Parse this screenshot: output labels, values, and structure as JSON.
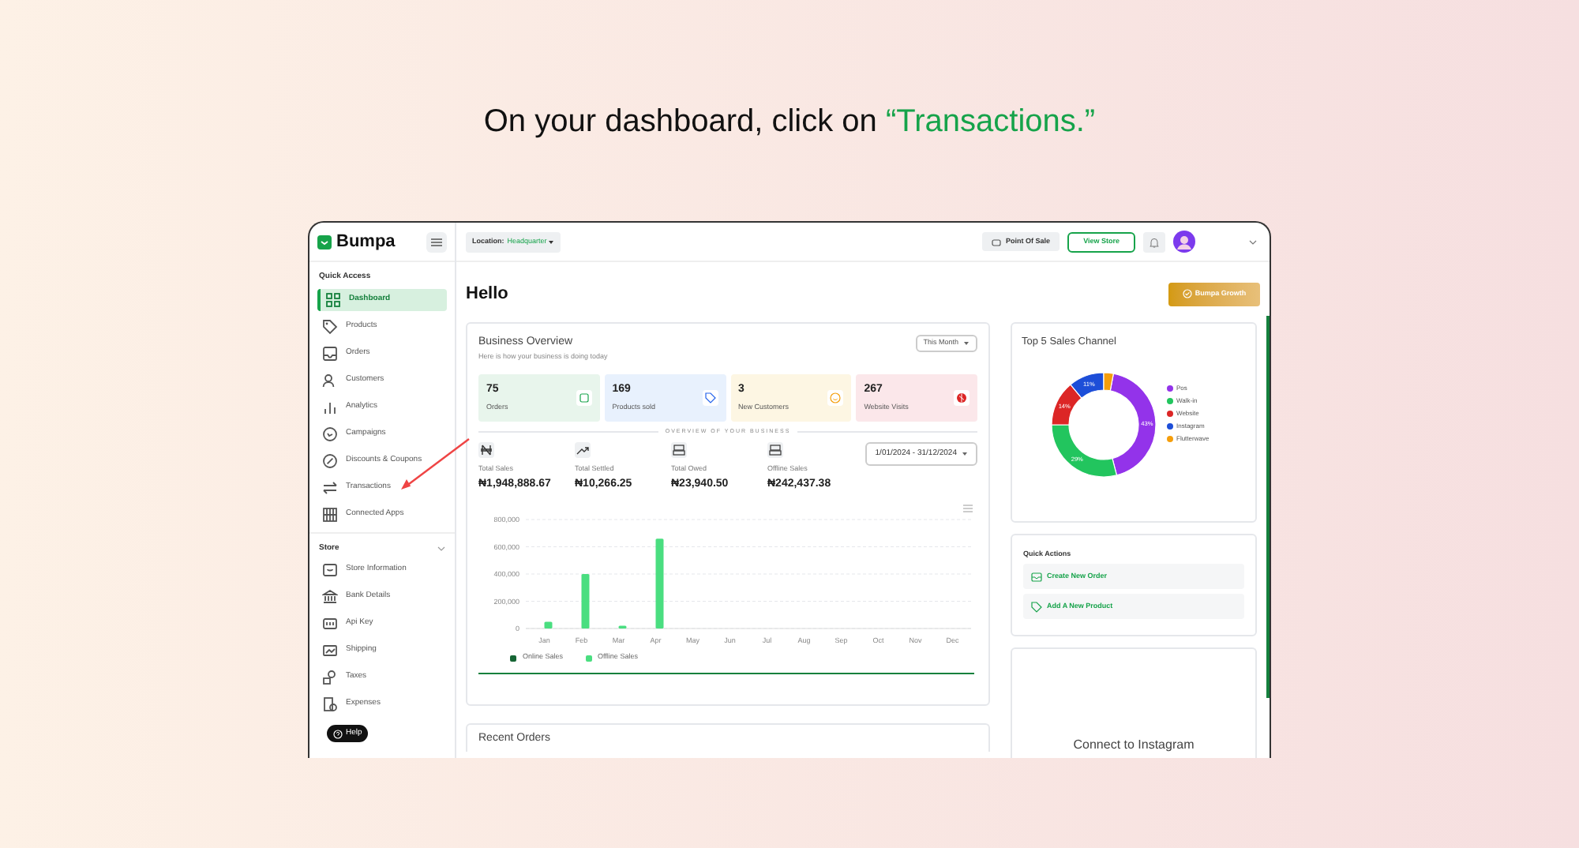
{
  "instruction": {
    "text": "On your dashboard, click on ",
    "highlight": "“Transactions.”"
  },
  "sidebar": {
    "brand": "Bumpa",
    "sections": [
      {
        "title": "Quick Access",
        "items": [
          {
            "label": "Dashboard",
            "selected": true
          },
          {
            "label": "Products",
            "selected": false
          },
          {
            "label": "Orders",
            "selected": false
          },
          {
            "label": "Customers",
            "selected": false
          },
          {
            "label": "Analytics",
            "selected": false
          },
          {
            "label": "Campaigns",
            "selected": false
          },
          {
            "label": "Discounts & Coupons",
            "selected": false
          },
          {
            "label": "Transactions",
            "selected": false
          },
          {
            "label": "Connected Apps",
            "selected": false
          }
        ]
      },
      {
        "title": "Store",
        "expanded": true,
        "items": [
          {
            "label": "Store Information",
            "selected": false
          },
          {
            "label": "Bank Details",
            "selected": false
          },
          {
            "label": "Api Key",
            "selected": false
          },
          {
            "label": "Shipping",
            "selected": false
          },
          {
            "label": "Taxes",
            "selected": false
          },
          {
            "label": "Expenses",
            "selected": false
          }
        ]
      }
    ]
  },
  "help_button": "Help",
  "topbar": {
    "location_label": "Location:",
    "location_value": "Headquarter",
    "pos_button": "Point Of Sale",
    "store_button": "View Store"
  },
  "greeting": "Hello",
  "growth_button": "Bumpa Growth",
  "overview": {
    "title": "Business Overview",
    "subtitle": "Here is how your business is doing today",
    "period": "This Month",
    "stats": [
      {
        "value": "75",
        "label": "Orders",
        "color": "#e8f5ec"
      },
      {
        "value": "169",
        "label": "Products sold",
        "color": "#e8f1fd"
      },
      {
        "value": "3",
        "label": "New Customers",
        "color": "#fdf6e3"
      },
      {
        "value": "267",
        "label": "Website Visits",
        "color": "#fbe7ea"
      }
    ],
    "divider_label": "OVERVIEW OF YOUR BUSINESS",
    "totals": [
      {
        "label": "Total Sales",
        "value": "₦1,948,888.67"
      },
      {
        "label": "Total Settled",
        "value": "₦10,266.25"
      },
      {
        "label": "Total Owed",
        "value": "₦23,940.50"
      },
      {
        "label": "Offline Sales",
        "value": "₦242,437.38"
      }
    ],
    "date_range": "1/01/2024 - 31/12/2024",
    "chart_data": {
      "type": "bar",
      "categories": [
        "Jan",
        "Feb",
        "Mar",
        "Apr",
        "May",
        "Jun",
        "Jul",
        "Aug",
        "Sep",
        "Oct",
        "Nov",
        "Dec"
      ],
      "series": [
        {
          "name": "Online Sales",
          "color": "#166534",
          "values": [
            0,
            0,
            0,
            0,
            0,
            0,
            0,
            0,
            0,
            0,
            0,
            0
          ]
        },
        {
          "name": "Offline Sales",
          "color": "#4ade80",
          "values": [
            50000,
            400000,
            20000,
            660000,
            0,
            0,
            0,
            0,
            0,
            0,
            0,
            0
          ]
        }
      ],
      "ylim": [
        0,
        800000
      ],
      "grid": true,
      "yticks": [
        {
          "value": 0,
          "label": "0"
        },
        {
          "value": 200000,
          "label": "200,000"
        },
        {
          "value": 400000,
          "label": "400,000"
        },
        {
          "value": 600000,
          "label": "600,000"
        },
        {
          "value": 800000,
          "label": "800,000"
        }
      ]
    }
  },
  "recent_orders": {
    "title": "Recent Orders"
  },
  "sales_channels": {
    "title": "Top 5 Sales Channel",
    "legend": [
      {
        "label": "Pos",
        "color": "#9333ea"
      },
      {
        "label": "Walk-in",
        "color": "#22c55e"
      },
      {
        "label": "Website",
        "color": "#dc2626"
      },
      {
        "label": "Instagram",
        "color": "#1d4ed8"
      },
      {
        "label": "Flutterwave",
        "color": "#f59e0b"
      }
    ],
    "chart_data": {
      "type": "donut",
      "series": [
        {
          "values": [
            43,
            29,
            14,
            11,
            3
          ]
        }
      ],
      "value_labels": [
        "43%",
        "29%",
        "14%",
        "11%",
        null
      ]
    }
  },
  "quick_actions": {
    "title": "Quick Actions",
    "items": [
      "Create New Order",
      "Add A New Product"
    ]
  },
  "instagram": {
    "title": "Connect to Instagram"
  }
}
